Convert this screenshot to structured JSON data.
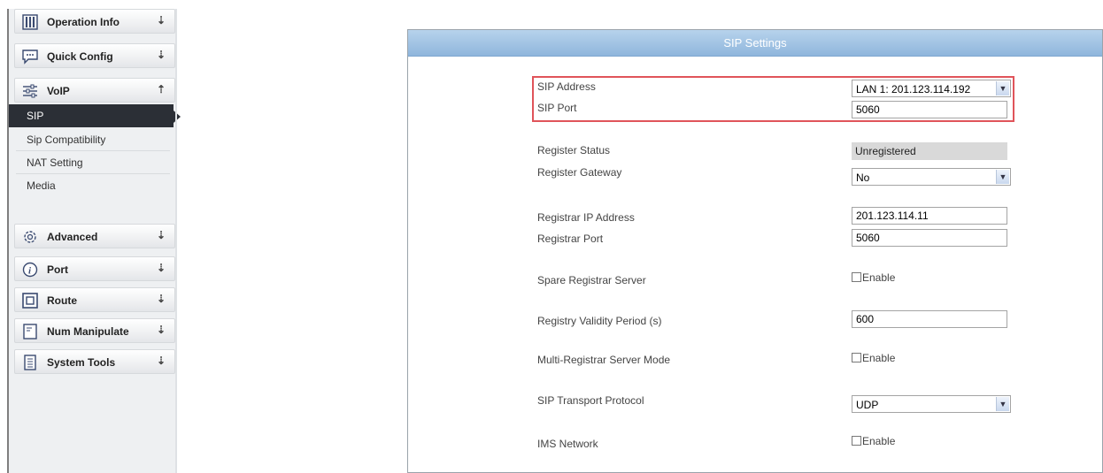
{
  "sidebar": {
    "menu": [
      {
        "label": "Operation Info",
        "icon": "bar-chart-icon"
      },
      {
        "label": "Quick Config",
        "icon": "chat-bubble-icon"
      },
      {
        "label": "VoIP",
        "icon": "sliders-icon"
      },
      {
        "label": "Advanced",
        "icon": "gear-icon"
      },
      {
        "label": "Port",
        "icon": "info-icon"
      },
      {
        "label": "Route",
        "icon": "square-icon"
      },
      {
        "label": "Num Manipulate",
        "icon": "document-icon"
      },
      {
        "label": "System Tools",
        "icon": "notepad-icon"
      }
    ],
    "voip_submenu": [
      "SIP",
      "Sip Compatibility",
      "NAT Setting",
      "Media"
    ]
  },
  "panel": {
    "title": "SIP Settings",
    "fields": {
      "sip_address": {
        "label": "SIP Address",
        "value": "LAN 1: 201.123.114.192"
      },
      "sip_port": {
        "label": "SIP Port",
        "value": "5060"
      },
      "register_status": {
        "label": "Register Status",
        "value": "Unregistered"
      },
      "register_gateway": {
        "label": "Register Gateway",
        "value": "No"
      },
      "registrar_ip": {
        "label": "Registrar IP Address",
        "value": "201.123.114.11"
      },
      "registrar_port": {
        "label": "Registrar Port",
        "value": "5060"
      },
      "spare_registrar": {
        "label": "Spare Registrar Server",
        "option": "Enable"
      },
      "validity_period": {
        "label": "Registry Validity Period (s)",
        "value": "600"
      },
      "multi_registrar": {
        "label": "Multi-Registrar Server Mode",
        "option": "Enable"
      },
      "transport": {
        "label": "SIP Transport Protocol",
        "value": "UDP"
      },
      "ims_network": {
        "label": "IMS Network",
        "option": "Enable"
      }
    }
  },
  "colors": {
    "highlight": "#e0545a",
    "header": "#8fb6dc",
    "active_item": "#2b2f36"
  }
}
